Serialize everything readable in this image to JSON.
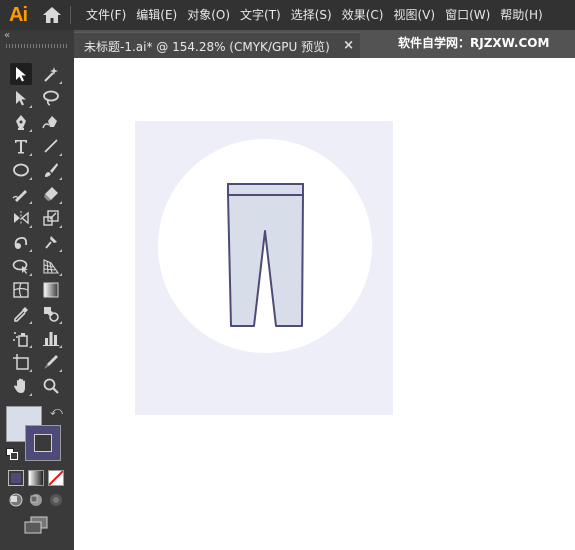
{
  "app": {
    "logo_text": "Ai",
    "home_icon": "home-icon"
  },
  "menu": [
    {
      "label": "文件(F)"
    },
    {
      "label": "编辑(E)"
    },
    {
      "label": "对象(O)"
    },
    {
      "label": "文字(T)"
    },
    {
      "label": "选择(S)"
    },
    {
      "label": "效果(C)"
    },
    {
      "label": "视图(V)"
    },
    {
      "label": "窗口(W)"
    },
    {
      "label": "帮助(H)"
    }
  ],
  "document_tab": {
    "title": "未标题-1.ai* @ 154.28% (CMYK/GPU 预览)",
    "close_label": "×"
  },
  "watermark": "软件自学网：RJZXW.COM",
  "toolbar": {
    "collapse_label": "«",
    "tools": [
      "selection-tool",
      "magic-wand-tool",
      "direct-selection-tool",
      "lasso-tool",
      "pen-tool",
      "curvature-tool",
      "type-tool",
      "line-segment-tool",
      "ellipse-tool",
      "paintbrush-tool",
      "shaper-tool",
      "eraser-tool",
      "rotate-tool",
      "scale-tool",
      "warp-tool",
      "puppet-warp-tool",
      "shape-builder-tool",
      "perspective-grid-tool",
      "mesh-tool",
      "gradient-tool",
      "eyedropper-tool",
      "blend-tool",
      "symbol-sprayer-tool",
      "column-graph-tool",
      "artboard-tool",
      "slice-tool",
      "hand-tool",
      "zoom-tool"
    ],
    "fill_color": "#d8dee9",
    "stroke_color": "#4f4b78"
  },
  "artwork": {
    "background_color": "#eeeef9",
    "circle_color": "#ffffff",
    "pants_fill": "#d8dee9",
    "pants_stroke": "#4f4b78"
  }
}
